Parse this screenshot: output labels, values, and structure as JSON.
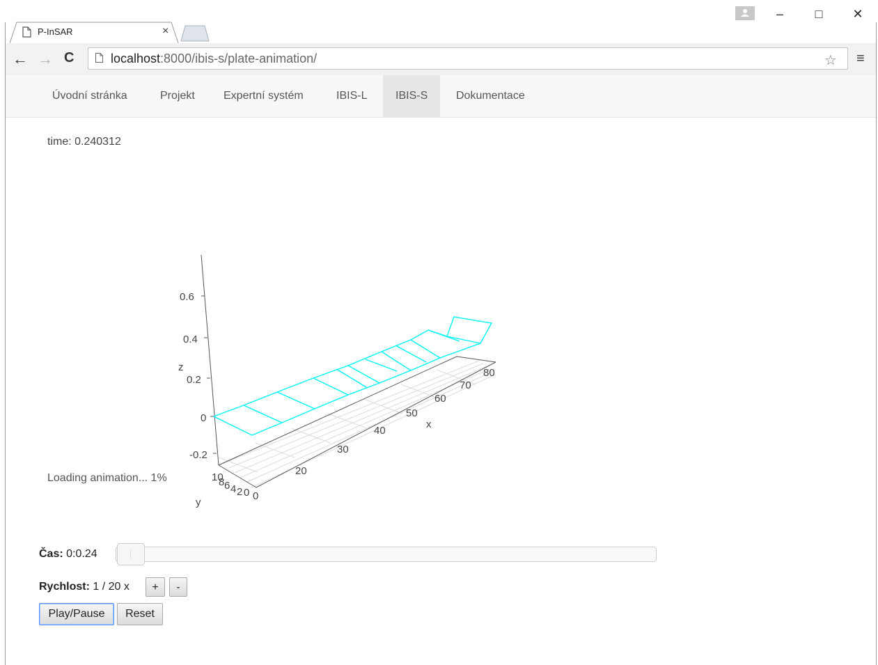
{
  "browser": {
    "tab_title": "P-InSAR",
    "tab_close": "×",
    "url_host": "localhost",
    "url_rest": ":8000/ibis-s/plate-animation/",
    "window_buttons": {
      "minimize": "–",
      "maximize": "□",
      "close": "✕"
    }
  },
  "nav": {
    "items": [
      {
        "label": "Úvodní stránka",
        "active": false
      },
      {
        "label": "Projekt",
        "active": false
      },
      {
        "label": "Expertní systém",
        "active": false
      },
      {
        "label": "IBIS-L",
        "active": false
      },
      {
        "label": "IBIS-S",
        "active": true
      },
      {
        "label": "Dokumentace",
        "active": false
      }
    ]
  },
  "content": {
    "time_text": "time: 0.240312",
    "loading_text": "Loading animation... 1%"
  },
  "chart_data": {
    "type": "line",
    "subtype": "3d-surface-wireframe",
    "series_color": "#00f5f5",
    "axes": {
      "x": {
        "label": "x",
        "ticks": [
          "20",
          "30",
          "40",
          "50",
          "60",
          "70",
          "80"
        ]
      },
      "y": {
        "label": "y",
        "ticks": [
          "10",
          "8",
          "6",
          "4",
          "2",
          "0"
        ]
      },
      "z": {
        "label": "z",
        "ticks": [
          "0.6",
          "0.4",
          "0.2",
          "0",
          "-0.2"
        ]
      },
      "origin_label": "0"
    }
  },
  "controls": {
    "time_label": "Čas:",
    "time_value": "0:0.24",
    "time_progress": 0.01,
    "speed_label": "Rychlost:",
    "speed_value": "1 / 20 x",
    "plus_label": "+",
    "minus_label": "-",
    "play_pause_label": "Play/Pause",
    "reset_label": "Reset"
  }
}
